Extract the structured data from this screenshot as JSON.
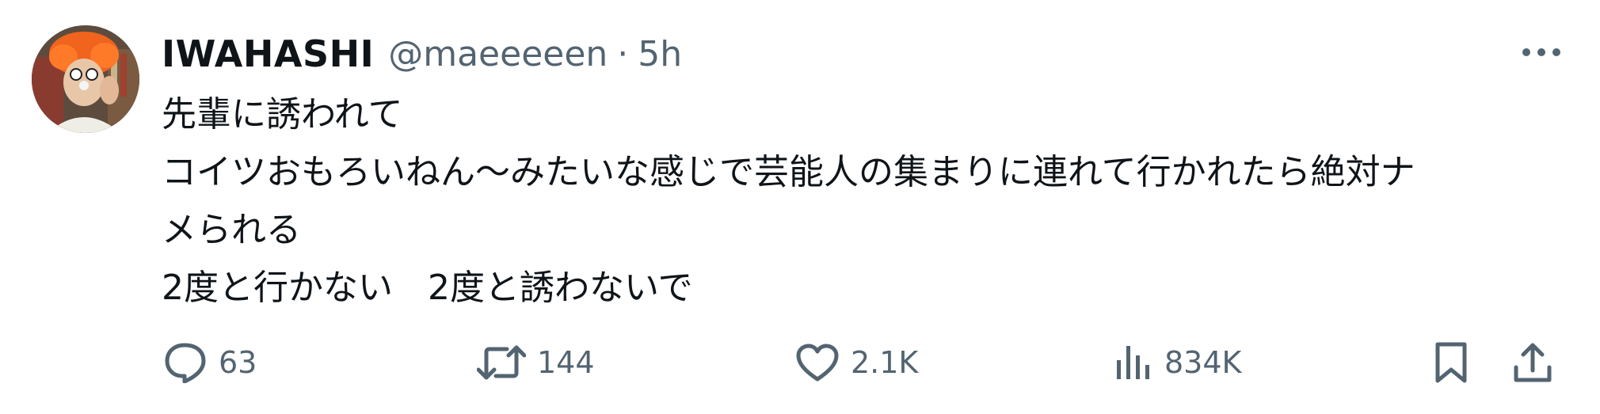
{
  "author": {
    "display_name": "IWAHASHI",
    "handle": "@maeeeeen",
    "separator": "·",
    "time": "5h"
  },
  "post": {
    "lines": [
      "先輩に誘われて",
      "コイツおもろいねん〜みたいな感じで芸能人の集まりに連れて行かれたら絶対ナ",
      "メられる",
      "2度と行かない　2度と誘わないで"
    ]
  },
  "actions": {
    "replies": "63",
    "reposts": "144",
    "likes": "2.1K",
    "views": "834K"
  },
  "icons": {
    "more": "more-horizontal-icon",
    "reply": "comment-bubble-icon",
    "repost": "repost-icon",
    "like": "heart-icon",
    "views": "bar-chart-icon",
    "bookmark": "bookmark-icon",
    "share": "share-icon"
  },
  "colors": {
    "text_primary": "#0f1419",
    "text_secondary": "#536471"
  }
}
